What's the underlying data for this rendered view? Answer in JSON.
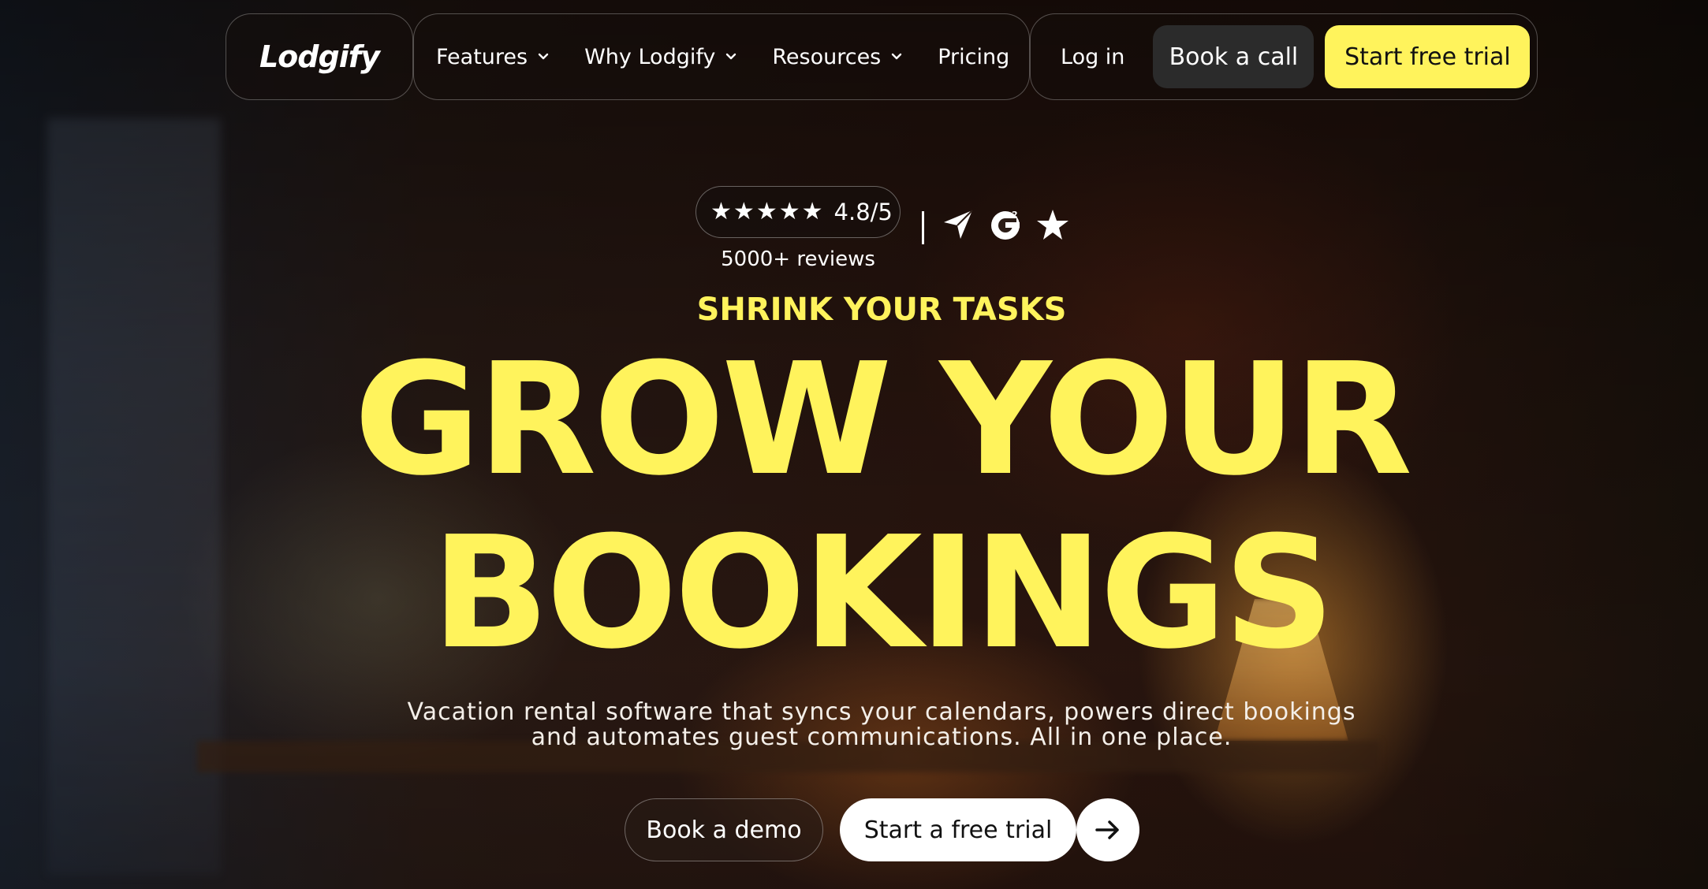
{
  "brand": {
    "logo": "Lodgify"
  },
  "nav": {
    "items": [
      {
        "label": "Features",
        "has_dropdown": true
      },
      {
        "label": "Why Lodgify",
        "has_dropdown": true
      },
      {
        "label": "Resources",
        "has_dropdown": true
      },
      {
        "label": "Pricing",
        "has_dropdown": false
      }
    ],
    "login": "Log in",
    "book_call": "Book a call",
    "start_trial": "Start free trial"
  },
  "rating": {
    "value": "4.8/5",
    "stars": 5,
    "reviews": "5000+ reviews",
    "badges": [
      "capterra-icon",
      "g2-icon",
      "star-icon"
    ]
  },
  "hero": {
    "eyebrow": "SHRINK YOUR TASKS",
    "headline_line1": "GROW YOUR",
    "headline_line2": "BOOKINGS",
    "subcopy_line1": "Vacation rental software that syncs your calendars, powers direct bookings",
    "subcopy_line2": "and automates guest communications. All in one place."
  },
  "cta": {
    "demo": "Book a demo",
    "free_trial": "Start a free trial",
    "arrow_icon": "arrow-right-icon"
  },
  "colors": {
    "accent_yellow": "#fff35c",
    "dark_button": "#2b2b2b",
    "white": "#ffffff"
  }
}
